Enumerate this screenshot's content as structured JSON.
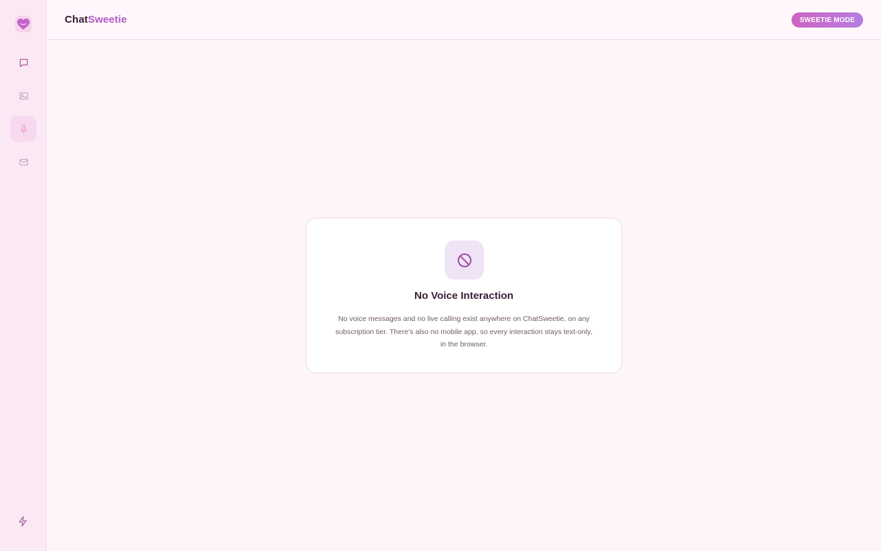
{
  "header": {
    "brand_part1": "Chat",
    "brand_part2": "Sweetie",
    "mode_label": "SWEETIE MODE"
  },
  "sidebar": {
    "items": [
      {
        "icon": "chat-icon",
        "active": false
      },
      {
        "icon": "image-icon",
        "active": false
      },
      {
        "icon": "microphone-icon",
        "active": true
      },
      {
        "icon": "mail-icon",
        "active": false
      }
    ],
    "bottom_icon": "lightning-icon"
  },
  "card": {
    "icon": "prohibited-icon",
    "title": "No Voice Interaction",
    "body_line1": "No voice messages and no live calling exist anywhere on ChatSweetie, on any",
    "body_line2": "subscription tier. There's also no mobile app, so every interaction stays text-only,",
    "body_line3": "in the browser."
  },
  "colors": {
    "accent": "#b05bc4",
    "sidebar_bg": "#fbe8f5",
    "page_bg": "#fef5fa",
    "pill_gradient_start": "#cf63c1",
    "pill_gradient_end": "#b37ee0"
  }
}
